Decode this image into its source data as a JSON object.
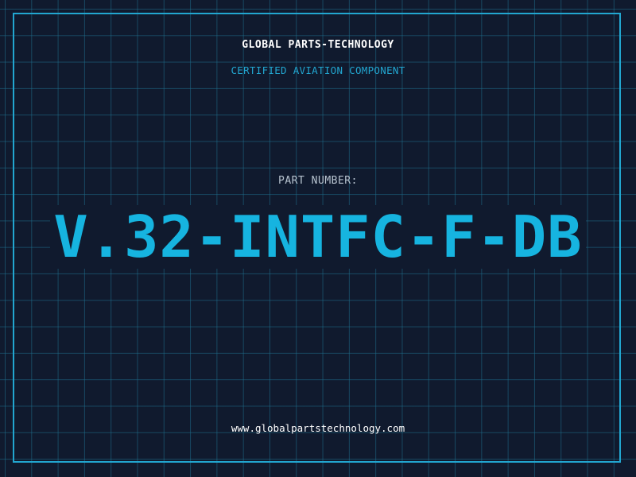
{
  "header": {
    "company": "GLOBAL PARTS-TECHNOLOGY",
    "tagline": "CERTIFIED AVIATION COMPONENT"
  },
  "part": {
    "label": "PART NUMBER:",
    "number": "V.32-INTFC-F-DB"
  },
  "footer": {
    "website": "www.globalpartstechnology.com"
  },
  "colors": {
    "background": "#101a2e",
    "grid": "#1e6e8c",
    "accent": "#16b4e0",
    "frame": "#22a6d0",
    "text": "#ffffff",
    "muted": "#b8c4d0"
  }
}
